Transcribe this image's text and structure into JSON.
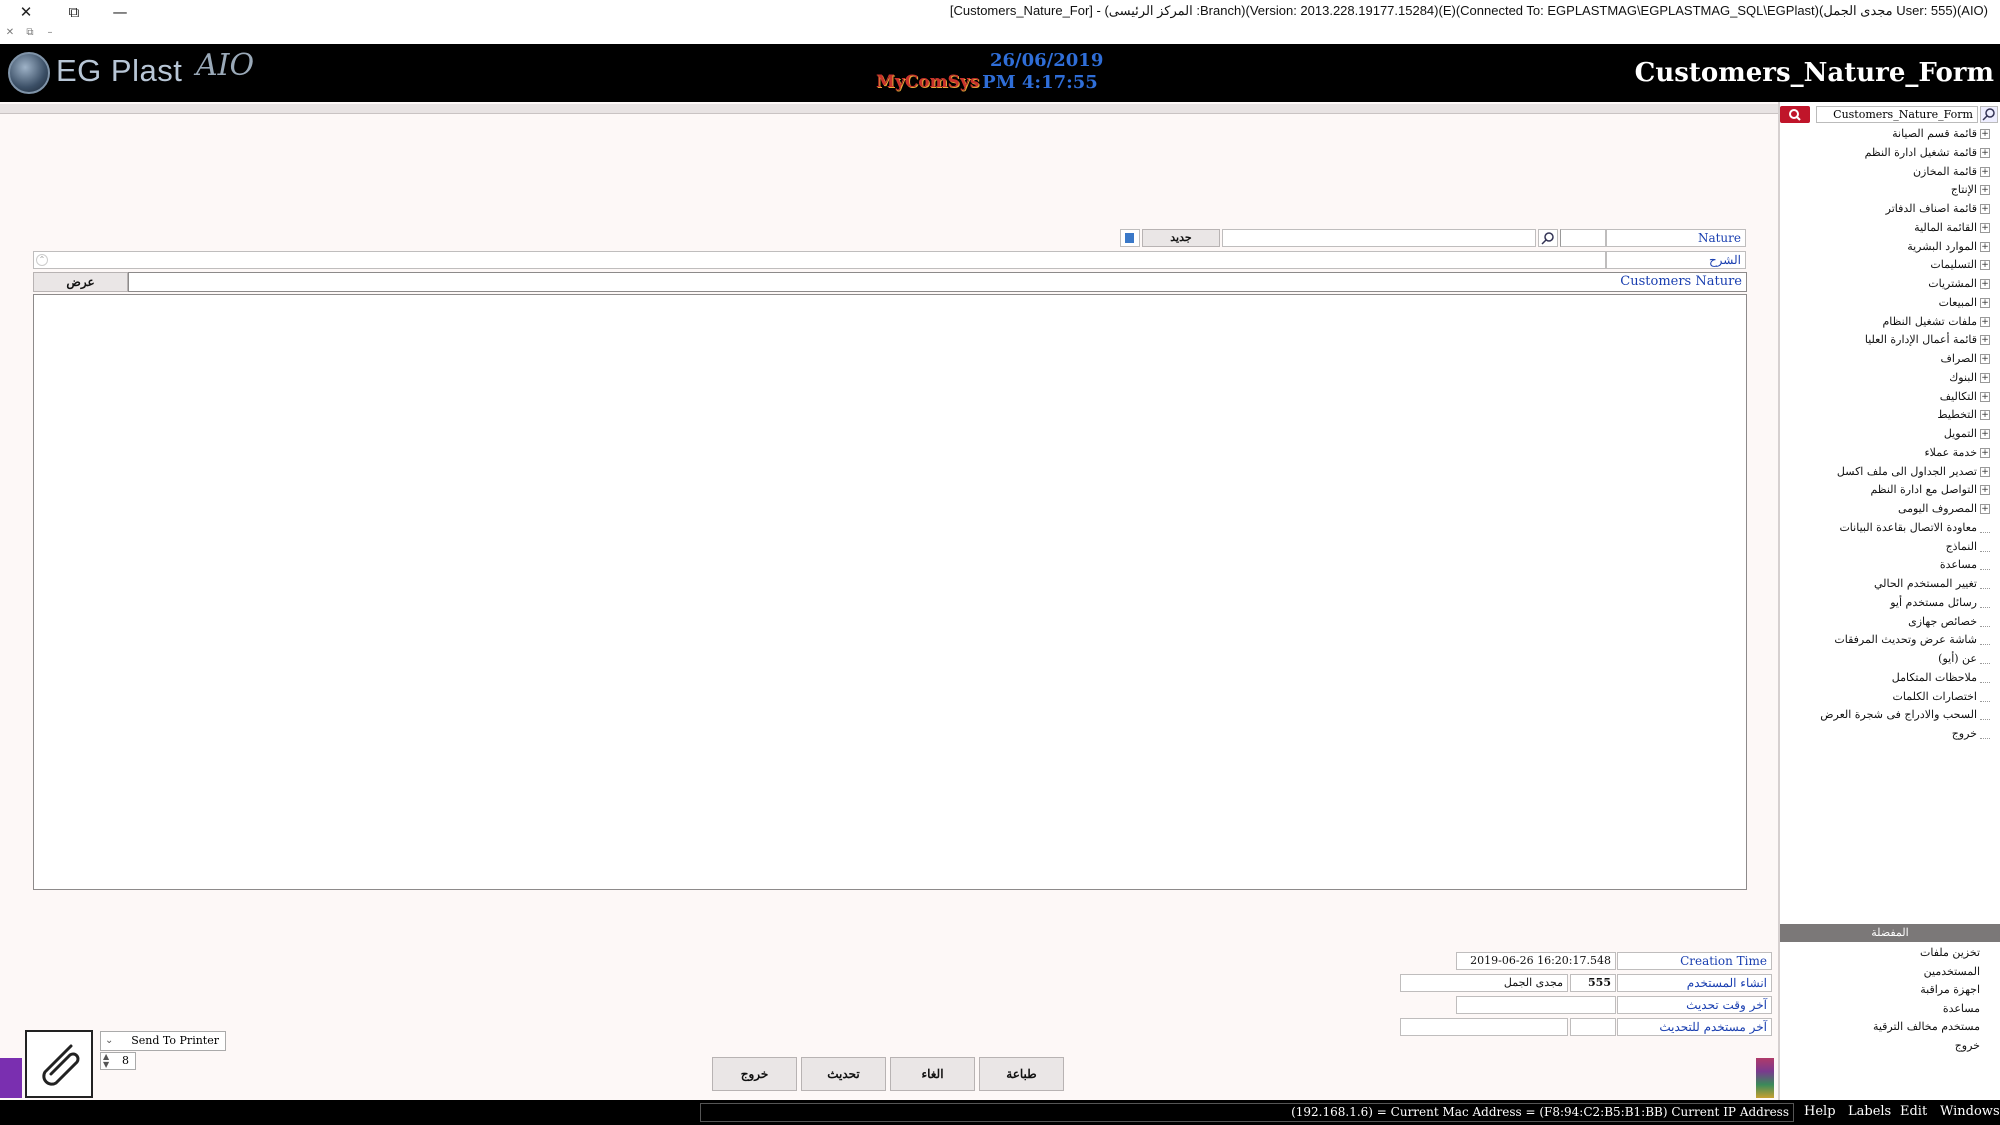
{
  "window": {
    "title": "[Customers_Nature_For] - (المركز الرئيسى :Branch)(Version: 2013.228.19177.15284)(E)(Connected To: EGPLASTMAG\\EGPLASTMAG_SQL\\EGPlast)(مجدى الجمل User: 555)(AIO)",
    "close": "✕",
    "restore": "⧉",
    "minimize": "—",
    "sub_close": "✕",
    "sub_restore": "⧉",
    "sub_min": "–"
  },
  "header": {
    "logo_text": "EG Plast",
    "logo_aio": "AIO",
    "vendor": "MyComSys",
    "date": "26/06/2019",
    "time": "PM 4:17:55",
    "form_name": "Customers_Nature_Form"
  },
  "side_panel": {
    "search_value": "Customers_Nature_Form",
    "search_icon": "magnifier-icon",
    "tree": [
      {
        "label": "قائمة قسم الصيانة",
        "expandable": true
      },
      {
        "label": "قائمة تشغيل ادارة النظم",
        "expandable": true
      },
      {
        "label": "قائمة المخازن",
        "expandable": true
      },
      {
        "label": "الإنتاج",
        "expandable": true
      },
      {
        "label": "قائمة اصناف الدفاتر",
        "expandable": true
      },
      {
        "label": "القائمة المالية",
        "expandable": true
      },
      {
        "label": "الموارد البشرية",
        "expandable": true
      },
      {
        "label": "التسليمات",
        "expandable": true
      },
      {
        "label": "المشتريات",
        "expandable": true
      },
      {
        "label": "المبيعات",
        "expandable": true
      },
      {
        "label": "ملفات تشغيل النظام",
        "expandable": true
      },
      {
        "label": "قائمة أعمال الإدارة العليا",
        "expandable": true
      },
      {
        "label": "الصراف",
        "expandable": true
      },
      {
        "label": "البنوك",
        "expandable": true
      },
      {
        "label": "التكاليف",
        "expandable": true
      },
      {
        "label": "التخطيط",
        "expandable": true
      },
      {
        "label": "التمويل",
        "expandable": true
      },
      {
        "label": "خدمة عملاء",
        "expandable": true
      },
      {
        "label": "تصدير الجداول الى ملف اكسل",
        "expandable": true
      },
      {
        "label": "التواصل مع ادارة النظم",
        "expandable": true
      },
      {
        "label": "المصروف اليومى",
        "expandable": true
      },
      {
        "label": "معاودة الاتصال بقاعدة البيانات",
        "expandable": false
      },
      {
        "label": "النماذج",
        "expandable": false
      },
      {
        "label": "مساعدة",
        "expandable": false
      },
      {
        "label": "تغيير المستخدم الحالي",
        "expandable": false
      },
      {
        "label": "رسائل مستخدم أيو",
        "expandable": false
      },
      {
        "label": "خصائص جهازى",
        "expandable": false
      },
      {
        "label": "شاشة عرض وتحديث المرفقات",
        "expandable": false
      },
      {
        "label": "عن (أيو)",
        "expandable": false
      },
      {
        "label": "ملاحظات المتكامل",
        "expandable": false
      },
      {
        "label": "اختصارات الكلمات",
        "expandable": false
      },
      {
        "label": "السحب والادراج فى شجرة العرض",
        "expandable": false
      },
      {
        "label": "خروج",
        "expandable": false
      }
    ],
    "favorites_title": "المفضلة",
    "favorites": [
      "تخزين ملفات",
      "المستخدمين",
      "اجهزة مراقبة",
      "مساعدة",
      "مستخدم مخالف الترقية",
      "خروج"
    ]
  },
  "form": {
    "nature_label": "Nature",
    "nature_value": "",
    "search_icon": "magnifier-icon",
    "search_text": "",
    "new_button": "جديد",
    "description_label": "الشرح",
    "description_value": "",
    "grid_header": "Customers Nature",
    "grid_button": "عرض",
    "creation_time_label": "Creation Time",
    "creation_time_value": "2019-06-26 16:20:17.548",
    "created_by_label": "انشاء المستخدم",
    "created_by_id": "555",
    "created_by_name": "مجدى الجمل",
    "updated_time_label": "آخر وقت تحديث",
    "updated_time_value": "",
    "updated_by_label": "آخر مستخدم للتحديث",
    "updated_by_id": "",
    "updated_by_name": ""
  },
  "bottom": {
    "printer_option": "Send To Printer",
    "copies": "8",
    "buttons": {
      "print": "طباعة",
      "cancel": "الغاء",
      "update": "تحديث",
      "exit": "خروج"
    },
    "status": "(192.168.1.6) = Current Mac Address = (F8:94:C2:B5:B1:BB) Current IP Address",
    "menu": [
      "Help",
      "Labels",
      "Edit",
      "Windows"
    ]
  }
}
